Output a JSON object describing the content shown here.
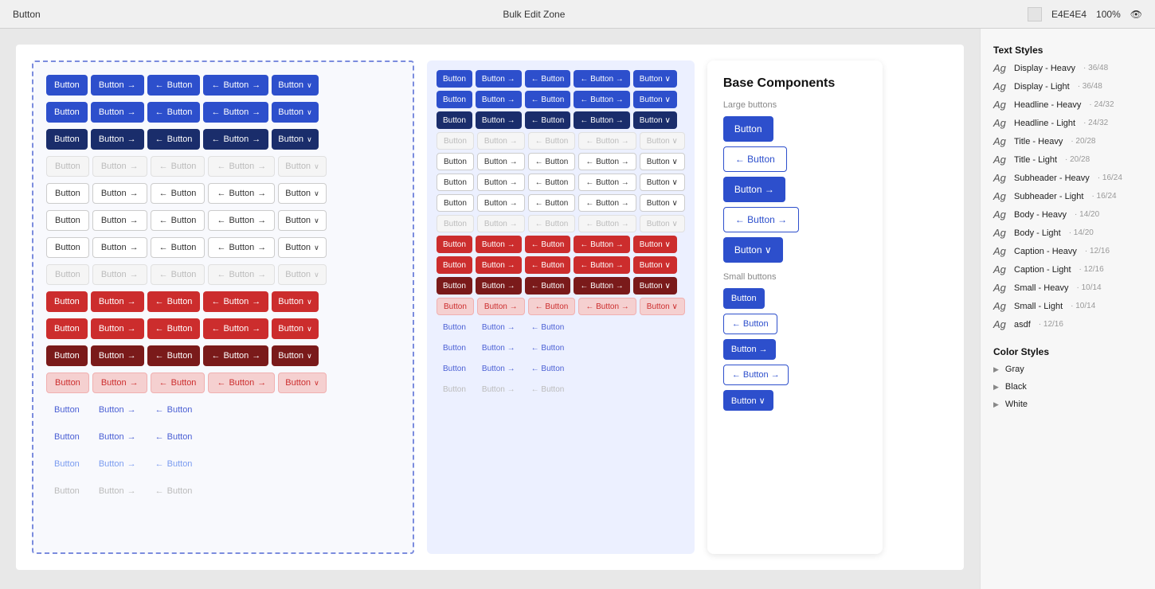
{
  "topBar": {
    "leftLabel": "Button",
    "centerLabel": "Bulk Edit Zone",
    "colorSwatch": "E4E4E4",
    "zoomLevel": "100%"
  },
  "rightSidebar": {
    "textStylesTitle": "Text Styles",
    "textStyles": [
      {
        "id": "display-heavy",
        "label": "Display - Heavy",
        "size": "36/48"
      },
      {
        "id": "display-light",
        "label": "Display - Light",
        "size": "36/48"
      },
      {
        "id": "headline-heavy",
        "label": "Headline - Heavy",
        "size": "24/32"
      },
      {
        "id": "headline-light",
        "label": "Headline - Light",
        "size": "24/32"
      },
      {
        "id": "title-heavy",
        "label": "Title - Heavy",
        "size": "20/28"
      },
      {
        "id": "title-light",
        "label": "Title - Light",
        "size": "20/28"
      },
      {
        "id": "subheader-heavy",
        "label": "Subheader - Heavy",
        "size": "16/24"
      },
      {
        "id": "subheader-light",
        "label": "Subheader - Light",
        "size": "16/24"
      },
      {
        "id": "body-heavy",
        "label": "Body - Heavy",
        "size": "14/20"
      },
      {
        "id": "body-light",
        "label": "Body - Light",
        "size": "14/20"
      },
      {
        "id": "caption-heavy",
        "label": "Caption - Heavy",
        "size": "12/16"
      },
      {
        "id": "caption-light",
        "label": "Caption - Light",
        "size": "12/16"
      },
      {
        "id": "small-heavy",
        "label": "Small - Heavy",
        "size": "10/14"
      },
      {
        "id": "small-light",
        "label": "Small - Light",
        "size": "10/14"
      },
      {
        "id": "asdf",
        "label": "asdf",
        "size": "12/16"
      }
    ],
    "colorStylesTitle": "Color Styles",
    "colorGroups": [
      {
        "id": "gray",
        "label": "Gray"
      },
      {
        "id": "black",
        "label": "Black"
      },
      {
        "id": "white",
        "label": "White"
      }
    ]
  },
  "baseComponents": {
    "title": "Base Components",
    "largeBtnsLabel": "Large buttons",
    "smallBtnsLabel": "Small buttons",
    "btnLabel": "Button"
  },
  "canvas": {
    "btnLabel": "Button"
  }
}
